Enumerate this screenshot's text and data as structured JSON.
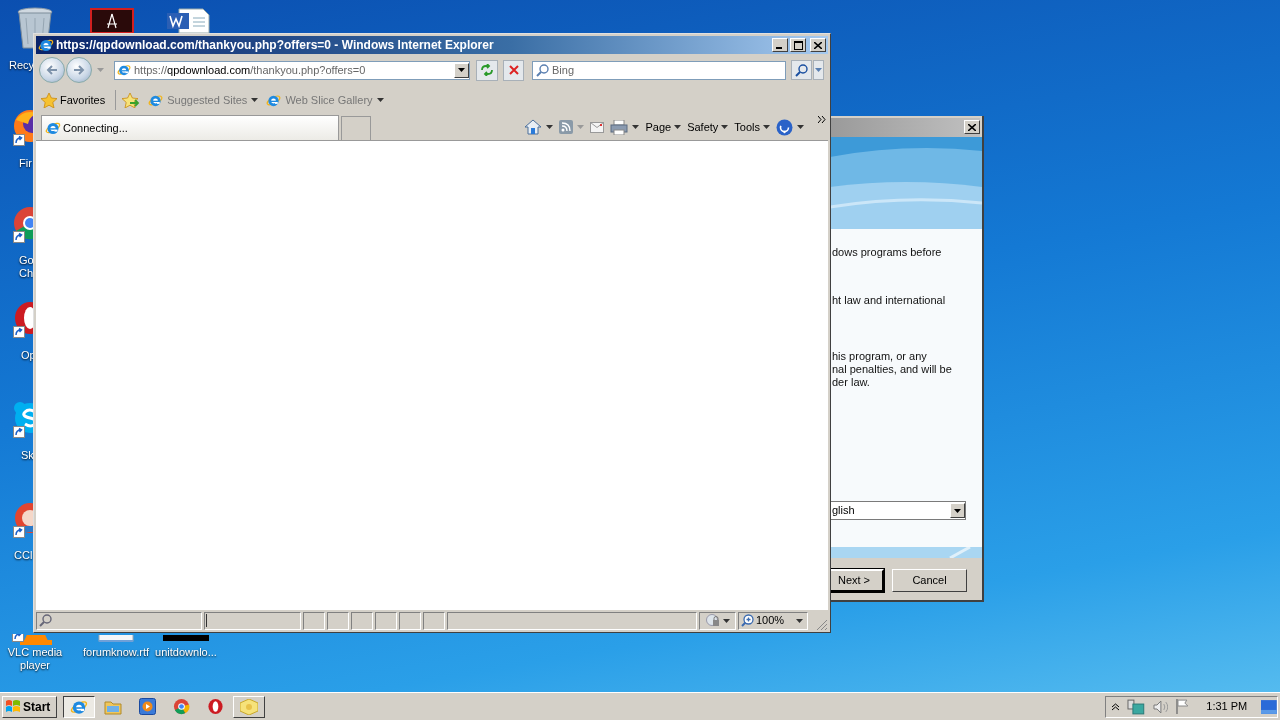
{
  "desktop": {
    "top_icons": [
      {
        "kind": "recycle",
        "label": "Recy"
      },
      {
        "kind": "pdf"
      },
      {
        "kind": "word"
      }
    ],
    "left_icons": [
      {
        "kind": "firefox",
        "lines": [
          "Fir"
        ]
      },
      {
        "kind": "chrome",
        "lines": [
          "Go",
          "Ch"
        ]
      },
      {
        "kind": "opera",
        "lines": [
          "Op"
        ]
      },
      {
        "kind": "skype",
        "lines": [
          "Sk"
        ]
      },
      {
        "kind": "ccleaner",
        "lines": [
          "CCl"
        ]
      }
    ],
    "bottom_icons": [
      {
        "kind": "vlc",
        "lines": [
          "VLC media",
          "player"
        ]
      },
      {
        "kind": "document",
        "lines": [
          "forumknow.rtf"
        ]
      },
      {
        "kind": "dark",
        "lines": [
          "unitdownlo..."
        ]
      }
    ]
  },
  "browser": {
    "title": "https://qpdownload.com/thankyou.php?offers=0 - Windows Internet Explorer",
    "address": {
      "scheme": "https://",
      "domain": "qpdownload.com",
      "path": "/thankyou.php?offers=0"
    },
    "search_placeholder": "Bing",
    "favorites": [
      {
        "kind": "star",
        "label": "Favorites"
      },
      {
        "kind": "add"
      },
      {
        "kind": "ie",
        "label": "Suggested Sites"
      },
      {
        "kind": "ie",
        "label": "Web Slice Gallery"
      }
    ],
    "tabs": [
      {
        "label": "Connecting...",
        "selected": true
      }
    ],
    "commands": [
      {
        "kind": "home"
      },
      {
        "kind": "feed"
      },
      {
        "kind": "mail"
      },
      {
        "kind": "print"
      },
      {
        "kind": "menu",
        "label": "Page"
      },
      {
        "kind": "menu",
        "label": "Safety"
      },
      {
        "kind": "menu",
        "label": "Tools"
      },
      {
        "kind": "help"
      }
    ],
    "zoom": "100%"
  },
  "dialog": {
    "paragraphs": [
      [
        "dows programs before"
      ],
      [
        "ht law and international"
      ],
      [
        "his program, or any",
        "nal penalties, and will be",
        "der law."
      ]
    ],
    "language": "glish",
    "buttons": [
      {
        "label": "Next >",
        "selected": true
      },
      {
        "label": "Cancel",
        "selected": false
      }
    ]
  },
  "taskbar": {
    "start": "Start",
    "apps": [
      {
        "kind": "ie",
        "selected": true
      },
      {
        "kind": "folder",
        "selected": false
      },
      {
        "kind": "media",
        "selected": false
      },
      {
        "kind": "chrome",
        "selected": false
      },
      {
        "kind": "opera",
        "selected": false
      },
      {
        "kind": "package",
        "selected": false
      }
    ],
    "clock": "1:31 PM"
  }
}
